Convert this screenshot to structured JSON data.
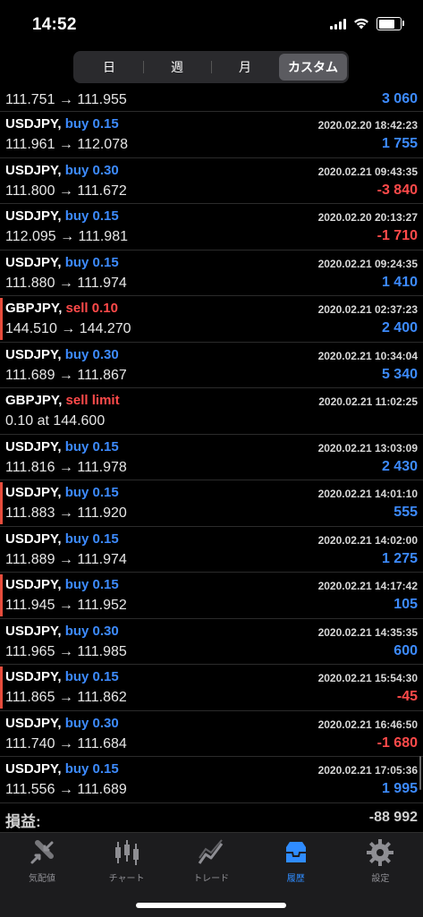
{
  "status": {
    "time": "14:52",
    "battery_level": 0.82
  },
  "segments": [
    {
      "label": "日",
      "active": false
    },
    {
      "label": "週",
      "active": false
    },
    {
      "label": "月",
      "active": false
    },
    {
      "label": "カスタム",
      "active": true
    }
  ],
  "first_row": {
    "prices": "111.751 → 111.955",
    "profit": "3 060"
  },
  "rows": [
    {
      "symbol": "USDJPY,",
      "side": "buy 0.15",
      "time": "2020.02.20 18:42:23",
      "prices": "111.961 → 112.078",
      "profit": "1 755",
      "neg": false,
      "marked": false
    },
    {
      "symbol": "USDJPY,",
      "side": "buy 0.30",
      "time": "2020.02.21 09:43:35",
      "prices": "111.800 → 111.672",
      "profit": "-3 840",
      "neg": true,
      "marked": false
    },
    {
      "symbol": "USDJPY,",
      "side": "buy 0.15",
      "time": "2020.02.20 20:13:27",
      "prices": "112.095 → 111.981",
      "profit": "-1 710",
      "neg": true,
      "marked": false
    },
    {
      "symbol": "USDJPY,",
      "side": "buy 0.15",
      "time": "2020.02.21 09:24:35",
      "prices": "111.880 → 111.974",
      "profit": "1 410",
      "neg": false,
      "marked": false
    },
    {
      "symbol": "GBPJPY,",
      "side": "sell 0.10",
      "time": "2020.02.21 02:37:23",
      "prices": "144.510 → 144.270",
      "profit": "2 400",
      "neg": false,
      "marked": true,
      "sell": true
    },
    {
      "symbol": "USDJPY,",
      "side": "buy 0.30",
      "time": "2020.02.21 10:34:04",
      "prices": "111.689 → 111.867",
      "profit": "5 340",
      "neg": false,
      "marked": false
    },
    {
      "symbol": "GBPJPY,",
      "side": "sell limit",
      "time": "2020.02.21 11:02:25",
      "prices": "0.10 at 144.600",
      "profit": "",
      "neg": false,
      "marked": false,
      "sell": true
    },
    {
      "symbol": "USDJPY,",
      "side": "buy 0.15",
      "time": "2020.02.21 13:03:09",
      "prices": "111.816 → 111.978",
      "profit": "2 430",
      "neg": false,
      "marked": false
    },
    {
      "symbol": "USDJPY,",
      "side": "buy 0.15",
      "time": "2020.02.21 14:01:10",
      "prices": "111.883 → 111.920",
      "profit": "555",
      "neg": false,
      "marked": true
    },
    {
      "symbol": "USDJPY,",
      "side": "buy 0.15",
      "time": "2020.02.21 14:02:00",
      "prices": "111.889 → 111.974",
      "profit": "1 275",
      "neg": false,
      "marked": false
    },
    {
      "symbol": "USDJPY,",
      "side": "buy 0.15",
      "time": "2020.02.21 14:17:42",
      "prices": "111.945 → 111.952",
      "profit": "105",
      "neg": false,
      "marked": true
    },
    {
      "symbol": "USDJPY,",
      "side": "buy 0.30",
      "time": "2020.02.21 14:35:35",
      "prices": "111.965 → 111.985",
      "profit": "600",
      "neg": false,
      "marked": false
    },
    {
      "symbol": "USDJPY,",
      "side": "buy 0.15",
      "time": "2020.02.21 15:54:30",
      "prices": "111.865 → 111.862",
      "profit": "-45",
      "neg": true,
      "marked": true
    },
    {
      "symbol": "USDJPY,",
      "side": "buy 0.30",
      "time": "2020.02.21 16:46:50",
      "prices": "111.740 → 111.684",
      "profit": "-1 680",
      "neg": true,
      "marked": false
    },
    {
      "symbol": "USDJPY,",
      "side": "buy 0.15",
      "time": "2020.02.21 17:05:36",
      "prices": "111.556 → 111.689",
      "profit": "1 995",
      "neg": false,
      "marked": false
    }
  ],
  "total": {
    "label": "損益:",
    "value": "-88 992"
  },
  "tabs": [
    {
      "label": "気配値",
      "icon": "quotes-icon",
      "active": false
    },
    {
      "label": "チャート",
      "icon": "chart-icon",
      "active": false
    },
    {
      "label": "トレード",
      "icon": "trade-icon",
      "active": false
    },
    {
      "label": "履歴",
      "icon": "history-icon",
      "active": true
    },
    {
      "label": "設定",
      "icon": "settings-icon",
      "active": false
    }
  ],
  "colors": {
    "buy": "#3d8bff",
    "sell": "#ff4a4a",
    "accent": "#2f8cff"
  }
}
